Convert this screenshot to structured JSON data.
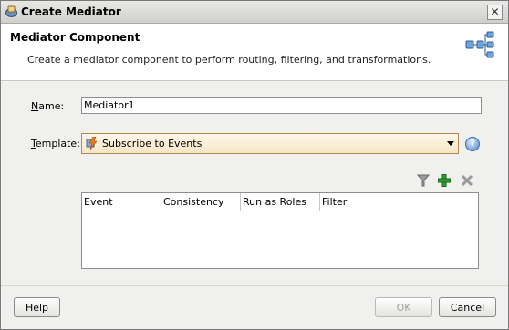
{
  "window": {
    "title": "Create Mediator",
    "close_glyph": "✕"
  },
  "header": {
    "title": "Mediator Component",
    "description": "Create a mediator component to perform routing, filtering, and transformations."
  },
  "form": {
    "name": {
      "label_prefix": "N",
      "label_rest": "ame:",
      "value": "Mediator1"
    },
    "template": {
      "label_prefix": "T",
      "label_rest": "emplate:",
      "selected": "Subscribe to Events",
      "help_glyph": "?"
    }
  },
  "events_table": {
    "columns": [
      "Event",
      "Consistency",
      "Run as Roles",
      "Filter"
    ],
    "rows": []
  },
  "buttons": {
    "help": "Help",
    "ok": "OK",
    "cancel": "Cancel"
  },
  "icons": {
    "app": "mediator-app-icon",
    "header": "mediator-component-icon",
    "filter": "filter-icon",
    "add": "add-icon",
    "delete": "delete-icon"
  },
  "colors": {
    "add_green": "#2e9e2e",
    "accent_orange": "#b5874a"
  }
}
